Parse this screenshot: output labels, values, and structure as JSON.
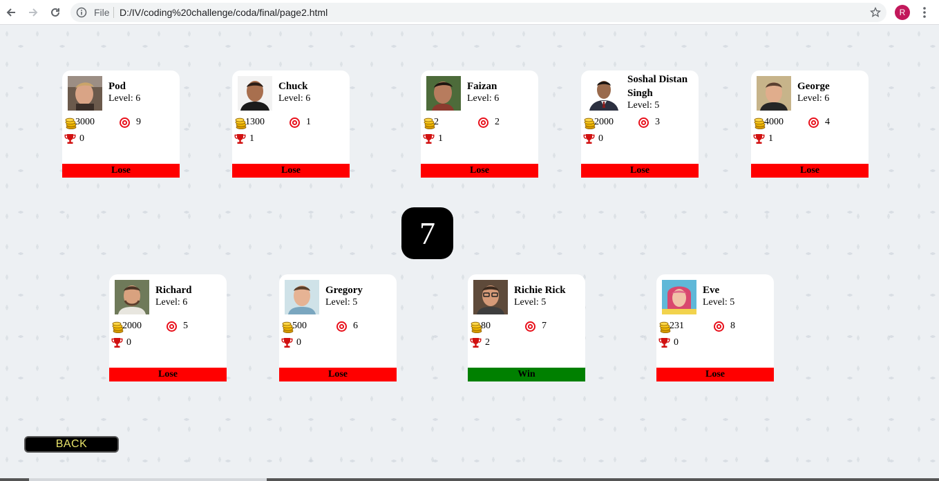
{
  "browser": {
    "file_label": "File",
    "url": "D:/IV/coding%20challenge/coda/final/page2.html",
    "profile_initial": "R"
  },
  "round": {
    "number": "7"
  },
  "back": {
    "label": "BACK"
  },
  "colors": {
    "lose": "#ff0000",
    "win": "#008000",
    "round_bg": "#000000",
    "back_text": "#e8e36a"
  },
  "players": [
    {
      "name": "Pod",
      "level": "Level: 6",
      "coins": "3000",
      "targets": "9",
      "trophies": "0",
      "result": "Lose"
    },
    {
      "name": "Chuck",
      "level": "Level: 6",
      "coins": "1300",
      "targets": "1",
      "trophies": "1",
      "result": "Lose"
    },
    {
      "name": "Faizan",
      "level": "Level: 6",
      "coins": "2",
      "targets": "2",
      "trophies": "1",
      "result": "Lose"
    },
    {
      "name": "Soshal Distan Singh",
      "level": "Level: 5",
      "coins": "2000",
      "targets": "3",
      "trophies": "0",
      "result": "Lose"
    },
    {
      "name": "George",
      "level": "Level: 6",
      "coins": "4000",
      "targets": "4",
      "trophies": "1",
      "result": "Lose"
    },
    {
      "name": "Richard",
      "level": "Level: 6",
      "coins": "2000",
      "targets": "5",
      "trophies": "0",
      "result": "Lose"
    },
    {
      "name": "Gregory",
      "level": "Level: 5",
      "coins": "500",
      "targets": "6",
      "trophies": "0",
      "result": "Lose"
    },
    {
      "name": "Richie Rick",
      "level": "Level: 5",
      "coins": "80",
      "targets": "7",
      "trophies": "2",
      "result": "Win"
    },
    {
      "name": "Eve",
      "level": "Level: 5",
      "coins": "231",
      "targets": "8",
      "trophies": "0",
      "result": "Lose"
    }
  ]
}
